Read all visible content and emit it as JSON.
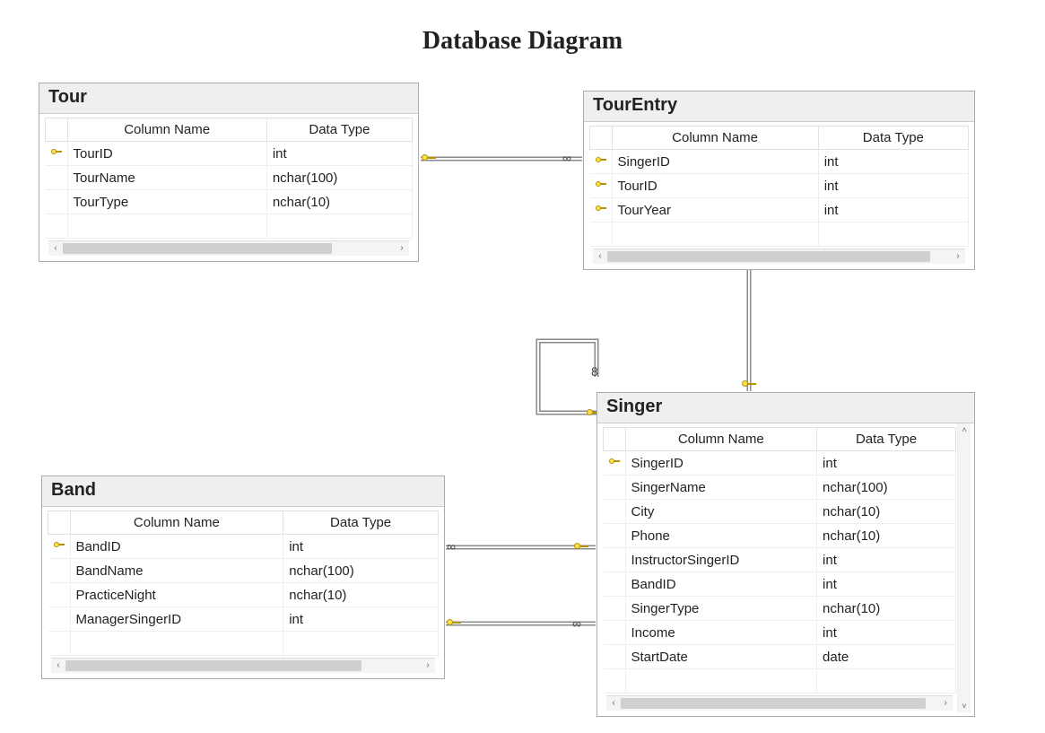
{
  "title": "Database Diagram",
  "headers": {
    "column_name": "Column Name",
    "data_type": "Data Type"
  },
  "entities": {
    "tour": {
      "name": "Tour",
      "columns": [
        {
          "pk": true,
          "name": "TourID",
          "type": "int"
        },
        {
          "pk": false,
          "name": "TourName",
          "type": "nchar(100)"
        },
        {
          "pk": false,
          "name": "TourType",
          "type": "nchar(10)"
        }
      ]
    },
    "tourEntry": {
      "name": "TourEntry",
      "columns": [
        {
          "pk": true,
          "name": "SingerID",
          "type": "int"
        },
        {
          "pk": true,
          "name": "TourID",
          "type": "int"
        },
        {
          "pk": true,
          "name": "TourYear",
          "type": "int"
        }
      ]
    },
    "band": {
      "name": "Band",
      "columns": [
        {
          "pk": true,
          "name": "BandID",
          "type": "int"
        },
        {
          "pk": false,
          "name": "BandName",
          "type": "nchar(100)"
        },
        {
          "pk": false,
          "name": "PracticeNight",
          "type": "nchar(10)"
        },
        {
          "pk": false,
          "name": "ManagerSingerID",
          "type": "int"
        }
      ]
    },
    "singer": {
      "name": "Singer",
      "columns": [
        {
          "pk": true,
          "name": "SingerID",
          "type": "int"
        },
        {
          "pk": false,
          "name": "SingerName",
          "type": "nchar(100)"
        },
        {
          "pk": false,
          "name": "City",
          "type": "nchar(10)"
        },
        {
          "pk": false,
          "name": "Phone",
          "type": "nchar(10)"
        },
        {
          "pk": false,
          "name": "InstructorSingerID",
          "type": "int"
        },
        {
          "pk": false,
          "name": "BandID",
          "type": "int"
        },
        {
          "pk": false,
          "name": "SingerType",
          "type": "nchar(10)"
        },
        {
          "pk": false,
          "name": "Income",
          "type": "int"
        },
        {
          "pk": false,
          "name": "StartDate",
          "type": "date"
        }
      ]
    }
  },
  "relationships": [
    {
      "from": "Tour.TourID",
      "to": "TourEntry.TourID",
      "from_card": "1",
      "to_card": "many"
    },
    {
      "from": "Singer.SingerID",
      "to": "TourEntry.SingerID",
      "from_card": "1",
      "to_card": "many"
    },
    {
      "from": "Singer.SingerID",
      "to": "Singer.InstructorSingerID",
      "from_card": "1",
      "to_card": "many",
      "self": true
    },
    {
      "from": "Band.BandID",
      "to": "Singer.BandID",
      "from_card": "many",
      "to_card": "1"
    },
    {
      "from": "Singer.SingerID",
      "to": "Band.ManagerSingerID",
      "from_card": "1",
      "to_card": "many"
    }
  ]
}
